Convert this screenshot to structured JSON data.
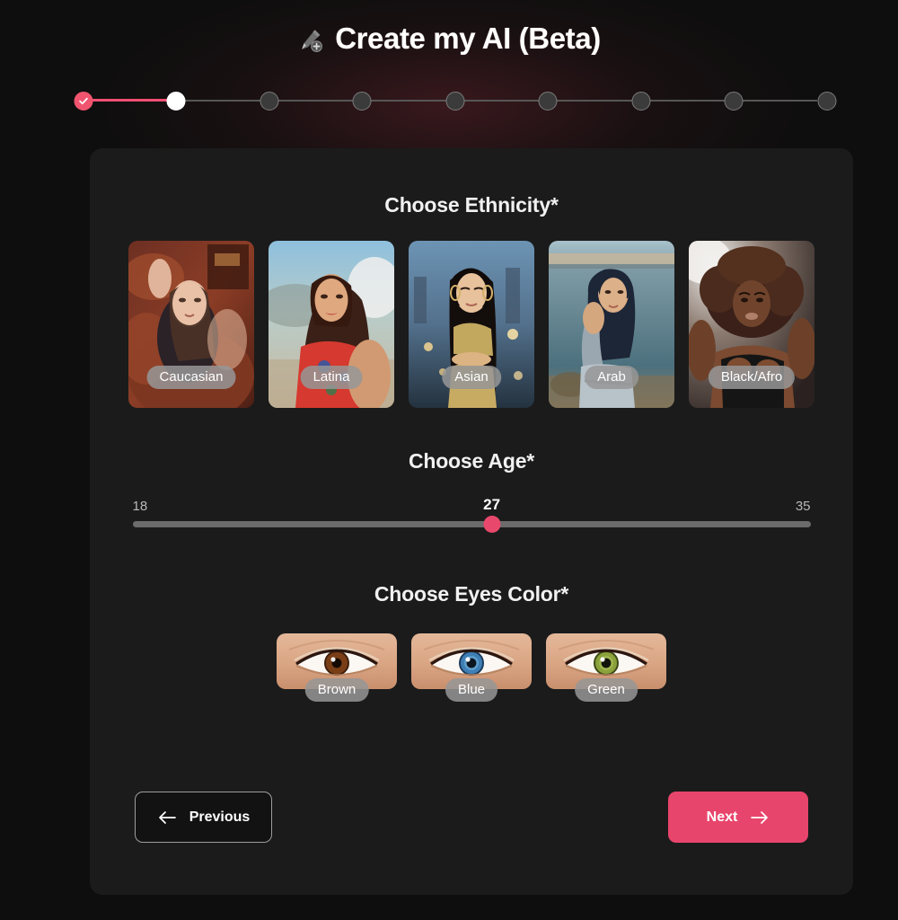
{
  "header": {
    "title": "Create my AI (Beta)",
    "icon": "pencil-plus-icon"
  },
  "stepper": {
    "total_steps": 9,
    "current_step": 2,
    "completed_steps": 1,
    "active_color": "#f0546f",
    "inactive_color": "#3b3b3b",
    "steps": [
      {
        "index": 1,
        "state": "completed"
      },
      {
        "index": 2,
        "state": "active"
      },
      {
        "index": 3,
        "state": "upcoming"
      },
      {
        "index": 4,
        "state": "upcoming"
      },
      {
        "index": 5,
        "state": "upcoming"
      },
      {
        "index": 6,
        "state": "upcoming"
      },
      {
        "index": 7,
        "state": "upcoming"
      },
      {
        "index": 8,
        "state": "upcoming"
      },
      {
        "index": 9,
        "state": "upcoming"
      }
    ]
  },
  "ethnicity": {
    "title": "Choose Ethnicity*",
    "options": [
      {
        "label": "Caucasian"
      },
      {
        "label": "Latina"
      },
      {
        "label": "Asian"
      },
      {
        "label": "Arab"
      },
      {
        "label": "Black/Afro"
      }
    ]
  },
  "age": {
    "title": "Choose Age*",
    "min": "18",
    "max": "35",
    "value": "27",
    "thumb_color": "#e8486c",
    "track_color": "#6b6b6b"
  },
  "eyes": {
    "title": "Choose Eyes Color*",
    "options": [
      {
        "label": "Brown"
      },
      {
        "label": "Blue"
      },
      {
        "label": "Green"
      }
    ]
  },
  "footer": {
    "previous_label": "Previous",
    "next_label": "Next",
    "previous_icon": "arrow-left-icon",
    "next_icon": "arrow-right-icon",
    "next_color": "#e8456c"
  }
}
